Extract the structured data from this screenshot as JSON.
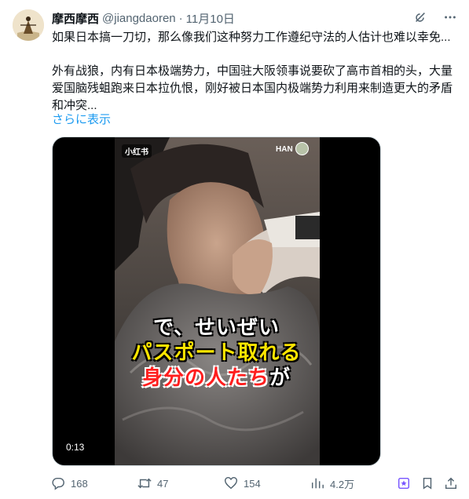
{
  "author": {
    "name": "摩西摩西",
    "handle": "@jiangdaoren",
    "separator": "·",
    "date": "11月10日"
  },
  "icons": {
    "grok": "grok-icon",
    "more": "more-icon",
    "reply": "reply-icon",
    "repost": "repost-icon",
    "like": "heart-icon",
    "views": "views-icon",
    "highlight": "highlight-icon",
    "bookmark": "bookmark-icon",
    "share": "share-icon"
  },
  "tweet": {
    "line1": "如果日本搞一刀切，那么像我们这种努力工作遵纪守法的人估计也难以幸免...",
    "line2": "外有战狼，内有日本极端势力，中国驻大阪领事说要砍了高市首相的头，大量爱国脑残蛆跑来日本拉仇恨，刚好被日本国内极端势力利用来制造更大的矛盾和冲突...",
    "show_more": "さらに表示"
  },
  "video": {
    "watermark_left": "小红书",
    "watermark_right": "HAN",
    "subtitle_line1": "で、せいぜい",
    "subtitle_line2": "パスポート取れる",
    "subtitle_line3_red": "身分の人たち",
    "subtitle_line3_white": "が",
    "timestamp": "0:13"
  },
  "actions": {
    "replies": "168",
    "reposts": "47",
    "likes": "154",
    "views": "4.2万"
  },
  "colors": {
    "text": "#0f1419",
    "secondary": "#536471",
    "link": "#1d9bf0",
    "subtitle_yellow": "#ffe600",
    "subtitle_red": "#ff1e1e"
  }
}
